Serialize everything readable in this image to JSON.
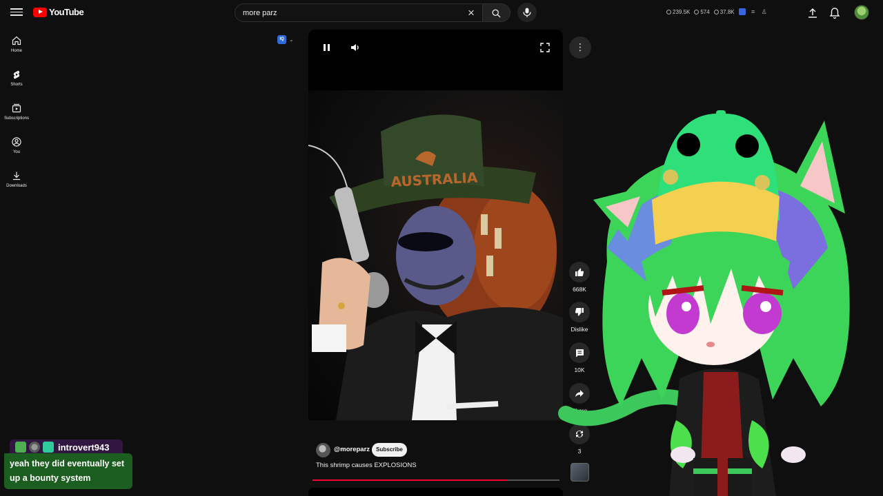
{
  "header": {
    "logo_text": "YouTube",
    "search_value": "more parz",
    "stats": [
      "239.5K",
      "574",
      "37.8K"
    ]
  },
  "sidebar": {
    "items": [
      {
        "label": "Home",
        "icon": "home-icon"
      },
      {
        "label": "Shorts",
        "icon": "shorts-icon"
      },
      {
        "label": "Subscriptions",
        "icon": "subscriptions-icon"
      },
      {
        "label": "You",
        "icon": "you-icon"
      },
      {
        "label": "Downloads",
        "icon": "downloads-icon"
      }
    ]
  },
  "extension": {
    "label": "IQ"
  },
  "video": {
    "hat_text": "AUSTRALIA",
    "progress_fraction": 0.79
  },
  "actions": {
    "likes": "668K",
    "dislike_label": "Dislike",
    "comments": "10K",
    "share_label": "Share",
    "remix_count": "3"
  },
  "channel": {
    "handle": "@moreparz",
    "subscribe_label": "Subscribe",
    "title": "This shrimp causes EXPLOSIONS"
  },
  "chat": {
    "username": "introvert943",
    "message": "yeah they did eventually set up a bounty system"
  },
  "colors": {
    "accent_red": "#ff0000",
    "progress_red": "#ff0033",
    "chat_green": "#1b5e20"
  }
}
